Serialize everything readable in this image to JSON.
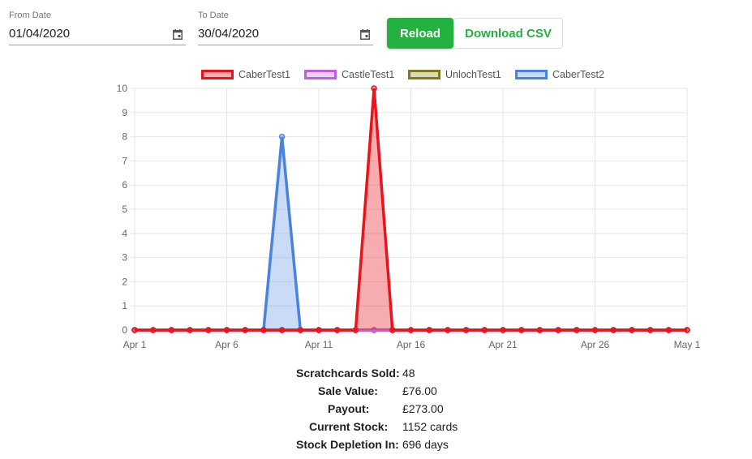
{
  "filters": {
    "from": {
      "label": "From Date",
      "value": "01/04/2020"
    },
    "to": {
      "label": "To Date",
      "value": "30/04/2020"
    }
  },
  "buttons": {
    "reload": "Reload",
    "download": "Download CSV"
  },
  "colors": {
    "accent": "#23b23f"
  },
  "icons": {
    "calendar": "calendar-icon"
  },
  "chart_data": {
    "type": "line",
    "x_tick_labels": [
      "Apr 1",
      "Apr 6",
      "Apr 11",
      "Apr 16",
      "Apr 21",
      "Apr 26",
      "May 1"
    ],
    "x_tick_indices": [
      0,
      5,
      10,
      15,
      20,
      25,
      30
    ],
    "ylim": [
      0,
      10
    ],
    "y_ticks": [
      0,
      1,
      2,
      3,
      4,
      5,
      6,
      7,
      8,
      9,
      10
    ],
    "grid": true,
    "legend_position": "top",
    "series": [
      {
        "name": "CaberTest1",
        "color": "#e8141b",
        "fill": "rgba(232,20,27,0.35)",
        "values": [
          0,
          0,
          0,
          0,
          0,
          0,
          0,
          0,
          0,
          0,
          0,
          0,
          0,
          10,
          0,
          0,
          0,
          0,
          0,
          0,
          0,
          0,
          0,
          0,
          0,
          0,
          0,
          0,
          0,
          0,
          0
        ]
      },
      {
        "name": "CastleTest1",
        "color": "#c25fe0",
        "fill": "rgba(200,120,230,0.35)",
        "values": [
          0,
          0,
          0,
          0,
          0,
          0,
          0,
          0,
          0,
          0,
          0,
          0,
          0,
          0,
          0,
          0,
          0,
          0,
          0,
          0,
          0,
          0,
          0,
          0,
          0,
          0,
          0,
          0,
          0,
          0,
          0
        ]
      },
      {
        "name": "UnlochTest1",
        "color": "#7f7a1e",
        "fill": "rgba(150,145,60,0.35)",
        "values": [
          0,
          0,
          0,
          0,
          0,
          0,
          0,
          0,
          0,
          0,
          0,
          0,
          0,
          0,
          0,
          0,
          0,
          0,
          0,
          0,
          0,
          0,
          0,
          0,
          0,
          0,
          0,
          0,
          0,
          0,
          0
        ]
      },
      {
        "name": "CaberTest2",
        "color": "#4a82e0",
        "fill": "rgba(120,165,235,0.4)",
        "values": [
          0,
          0,
          0,
          0,
          0,
          0,
          0,
          0,
          8,
          0,
          0,
          0,
          0,
          0,
          0,
          0,
          0,
          0,
          0,
          0,
          0,
          0,
          0,
          0,
          0,
          0,
          0,
          0,
          0,
          0,
          0
        ]
      }
    ]
  },
  "stats": [
    {
      "label": "Scratchcards Sold:",
      "value": "48"
    },
    {
      "label": "Sale Value:",
      "value": "£76.00"
    },
    {
      "label": "Payout:",
      "value": "£273.00"
    },
    {
      "label": "Current Stock:",
      "value": "1152 cards"
    },
    {
      "label": "Stock Depletion In:",
      "value": "696 days"
    }
  ]
}
